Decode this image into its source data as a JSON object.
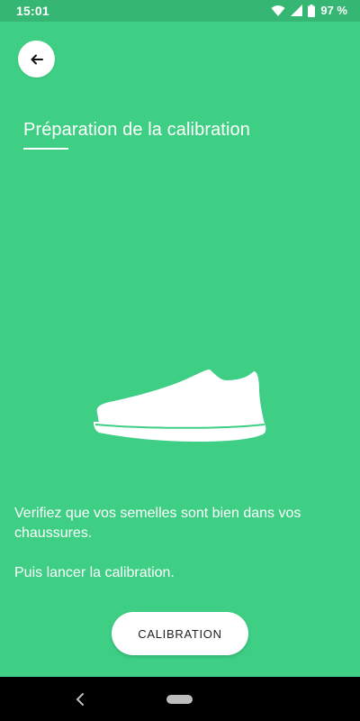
{
  "status_bar": {
    "time": "15:01",
    "battery": "97 %",
    "icons": [
      "wifi-icon",
      "signal-icon",
      "battery-icon"
    ]
  },
  "header": {
    "back_icon": "arrow-left-icon"
  },
  "title": "Préparation de la calibration",
  "illustration": {
    "icon": "sneaker-icon"
  },
  "instructions": {
    "line1": "Verifiez que vos semelles sont bien dans vos chaussures.",
    "line2": "Puis lancer la calibration."
  },
  "cta": {
    "label": "CALIBRATION"
  },
  "nav": {
    "icons": [
      "nav-back-icon",
      "nav-home-icon"
    ]
  },
  "colors": {
    "background": "#3ecf84",
    "status_bar": "#36b673",
    "text": "#ffffff",
    "button_bg": "#ffffff",
    "button_text": "#222222",
    "nav_bar": "#000000"
  }
}
